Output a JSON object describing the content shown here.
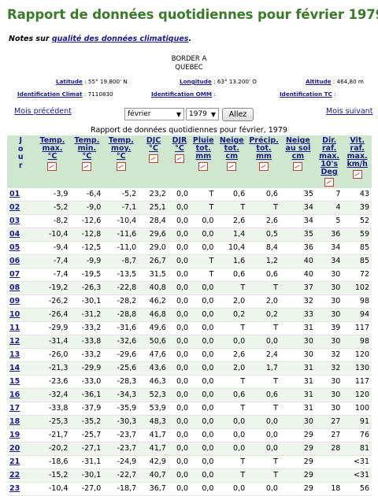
{
  "title": "Rapport de données quotidiennes pour février 1979",
  "notes": {
    "prefix": "Notes sur",
    "link": "qualité des données climatiques",
    "suffix": "."
  },
  "station": {
    "name": "BORDER A",
    "province": "QUEBEC"
  },
  "meta": {
    "latitude_label": "Latitude",
    "latitude_value": ": 55° 19.800' N",
    "longitude_label": "Longitude",
    "longitude_value": ": 63° 13.200' O",
    "altitude_label": "Altitude",
    "altitude_value": ": 464,80 m",
    "climate_id_label": "Identification Climat",
    "climate_id_value": ": 7110830",
    "omm_id_label": "Identification OMM",
    "omm_id_value": ":",
    "tc_id_label": "Identification TC",
    "tc_id_value": ":"
  },
  "nav": {
    "prev": "Mois précédent",
    "next": "Mois suivant",
    "month": "février",
    "year": "1979",
    "go": "Allez"
  },
  "caption": "Rapport de données quotidiennes pour février, 1979",
  "headers": [
    "J\no\nu\nr",
    "Temp.\nmax.\n°C",
    "Temp.\nmin.\n°C",
    "Temp.\nmoy.\n°C",
    "DJC\n°C",
    "DJR\n°C",
    "Pluie\ntot.\nmm",
    "Neige\ntot.\ncm",
    "Précip.\ntot.\nmm",
    "Neige\nau sol\ncm",
    "Dir.\nraf.\nmax.\n10's\nDeg",
    "Vit.\nraf.\nmax.\nkm/h"
  ],
  "rows": [
    [
      "01",
      "-3,9",
      "-6,4",
      "-5,2",
      "23,2",
      "0,0",
      "T",
      "0,6",
      "0,6",
      "35",
      "7",
      "43"
    ],
    [
      "02",
      "-5,2",
      "-9,0",
      "-7,1",
      "25,1",
      "0,0",
      "T",
      "T",
      "T",
      "34",
      "4",
      "39"
    ],
    [
      "03",
      "-8,2",
      "-12,6",
      "-10,4",
      "28,4",
      "0,0",
      "0,0",
      "2,6",
      "2,6",
      "34",
      "5",
      "52"
    ],
    [
      "04",
      "-10,4",
      "-12,8",
      "-11,6",
      "29,6",
      "0,0",
      "0,0",
      "1,4",
      "0,5",
      "35",
      "36",
      "59"
    ],
    [
      "05",
      "-9,4",
      "-12,5",
      "-11,0",
      "29,0",
      "0,0",
      "0,0",
      "10,4",
      "8,4",
      "36",
      "34",
      "85"
    ],
    [
      "06",
      "-7,4",
      "-9,9",
      "-8,7",
      "26,7",
      "0,0",
      "T",
      "1,6",
      "1,2",
      "40",
      "34",
      "85"
    ],
    [
      "07",
      "-7,4",
      "-19,5",
      "-13,5",
      "31,5",
      "0,0",
      "T",
      "0,6",
      "0,6",
      "40",
      "30",
      "72"
    ],
    [
      "08",
      "-19,2",
      "-26,3",
      "-22,8",
      "40,8",
      "0,0",
      "0,0",
      "T",
      "T",
      "37",
      "30",
      "102"
    ],
    [
      "09",
      "-26,2",
      "-30,1",
      "-28,2",
      "46,2",
      "0,0",
      "0,0",
      "2,0",
      "2,0",
      "32",
      "30",
      "98"
    ],
    [
      "10",
      "-26,4",
      "-31,2",
      "-28,8",
      "46,8",
      "0,0",
      "0,0",
      "0,2",
      "0,2",
      "33",
      "30",
      "94"
    ],
    [
      "11",
      "-29,9",
      "-33,2",
      "-31,6",
      "49,6",
      "0,0",
      "0,0",
      "T",
      "T",
      "31",
      "39",
      "117"
    ],
    [
      "12",
      "-31,4",
      "-33,8",
      "-32,6",
      "50,6",
      "0,0",
      "0,0",
      "0,0",
      "0,0",
      "30",
      "30",
      "98"
    ],
    [
      "13",
      "-26,0",
      "-33,2",
      "-29,6",
      "47,6",
      "0,0",
      "0,0",
      "2,6",
      "2,4",
      "30",
      "32",
      "120"
    ],
    [
      "14",
      "-21,3",
      "-29,9",
      "-25,6",
      "43,6",
      "0,0",
      "0,0",
      "2,0",
      "1,7",
      "31",
      "32",
      "130"
    ],
    [
      "15",
      "-23,6",
      "-33,0",
      "-28,3",
      "46,3",
      "0,0",
      "0,0",
      "T",
      "T",
      "31",
      "30",
      "117"
    ],
    [
      "16",
      "-32,4",
      "-36,1",
      "-34,3",
      "52,3",
      "0,0",
      "0,0",
      "0,6",
      "0,6",
      "31",
      "30",
      "120"
    ],
    [
      "17",
      "-33,8",
      "-37,9",
      "-35,9",
      "53,9",
      "0,0",
      "0,0",
      "T",
      "T",
      "31",
      "30",
      "100"
    ],
    [
      "18",
      "-25,3",
      "-35,2",
      "-30,3",
      "48,3",
      "0,0",
      "0,0",
      "0,0",
      "0,0",
      "30",
      "27",
      "91"
    ],
    [
      "19",
      "-21,7",
      "-25,7",
      "-23,7",
      "41,7",
      "0,0",
      "0,0",
      "0,0",
      "0,0",
      "29",
      "27",
      "76"
    ],
    [
      "20",
      "-20,2",
      "-27,1",
      "-23,7",
      "41,7",
      "0,0",
      "0,0",
      "0,0",
      "0,0",
      "29",
      "28",
      "81"
    ],
    [
      "21",
      "-18,6",
      "-31,1",
      "-24,9",
      "42,9",
      "0,0",
      "0,0",
      "T",
      "T",
      "29",
      "",
      "<31"
    ],
    [
      "22",
      "-15,2",
      "-30,1",
      "-22,7",
      "40,7",
      "0,0",
      "0,0",
      "T",
      "T",
      "29",
      "",
      "<31"
    ],
    [
      "23",
      "-10,4",
      "-27,0",
      "-18,7",
      "36,7",
      "0,0",
      "0,0",
      "0,0",
      "0,0",
      "29",
      "18",
      "56"
    ]
  ]
}
